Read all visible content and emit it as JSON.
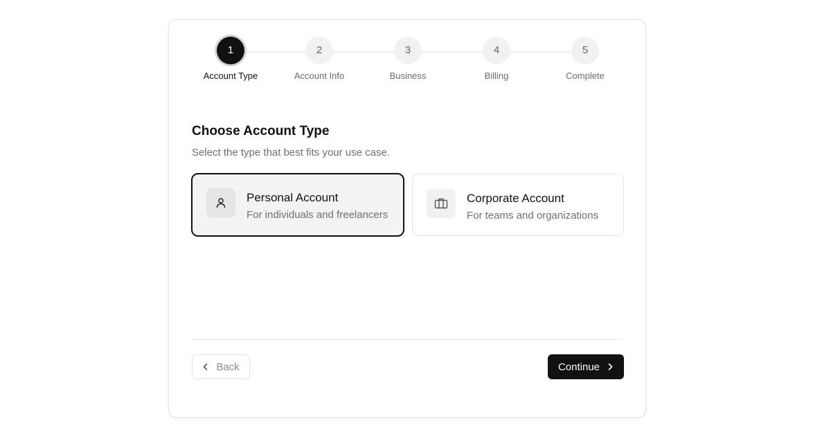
{
  "stepper": {
    "steps": [
      {
        "number": "1",
        "label": "Account Type",
        "state": "active"
      },
      {
        "number": "2",
        "label": "Account Info",
        "state": "upcoming"
      },
      {
        "number": "3",
        "label": "Business",
        "state": "upcoming"
      },
      {
        "number": "4",
        "label": "Billing",
        "state": "upcoming"
      },
      {
        "number": "5",
        "label": "Complete",
        "state": "upcoming"
      }
    ]
  },
  "main": {
    "title": "Choose Account Type",
    "subtitle": "Select the type that best fits your use case.",
    "options": [
      {
        "title": "Personal Account",
        "description": "For individuals and freelancers",
        "icon": "user-icon",
        "selected": true
      },
      {
        "title": "Corporate Account",
        "description": "For teams and organizations",
        "icon": "briefcase-icon",
        "selected": false
      }
    ]
  },
  "footer": {
    "back_label": "Back",
    "back_icon": "chevron-left-icon",
    "continue_label": "Continue",
    "continue_icon": "chevron-right-icon"
  },
  "colors": {
    "accent": "#111111",
    "muted_text": "#6f6f6f",
    "border": "#e3e3e3"
  }
}
